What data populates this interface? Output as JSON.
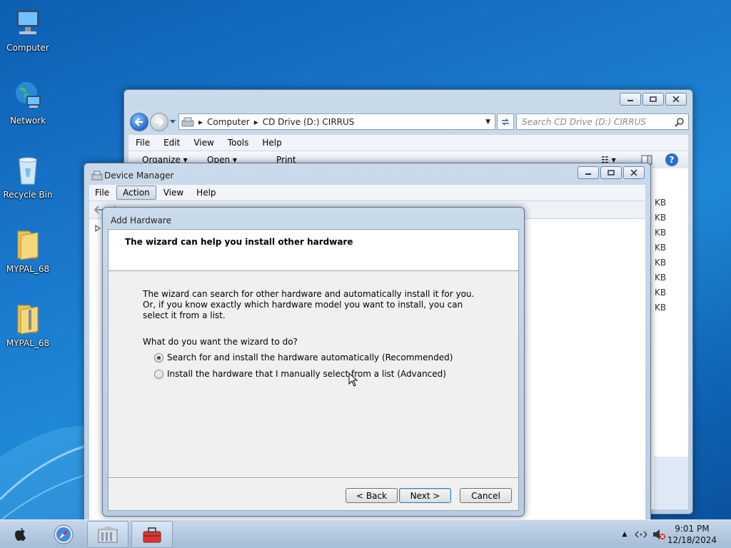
{
  "desktop": {
    "icons": [
      {
        "label": "Computer",
        "icon": "computer-icon"
      },
      {
        "label": "Network",
        "icon": "network-globe-icon"
      },
      {
        "label": "Recycle Bin",
        "icon": "recycle-bin-icon"
      },
      {
        "label": "MYPAL_68",
        "icon": "folder-icon"
      },
      {
        "label": "MYPAL_68",
        "icon": "zip-folder-icon"
      }
    ]
  },
  "explorer": {
    "breadcrumb": [
      "Computer",
      "CD Drive (D:) CIRRUS"
    ],
    "search_placeholder": "Search CD Drive (D:) CIRRUS",
    "menu": [
      "File",
      "Edit",
      "View",
      "Tools",
      "Help"
    ],
    "toolbar": {
      "organize": "Organize",
      "open": "Open",
      "print": "Print"
    },
    "sizes": [
      "KB",
      "KB",
      "KB",
      "KB",
      "KB",
      "KB",
      "KB",
      "KB"
    ]
  },
  "device_manager": {
    "title": "Device Manager",
    "menu": [
      "File",
      "Action",
      "View",
      "Help"
    ],
    "active_menu": "Action"
  },
  "add_hardware": {
    "title": "Add Hardware",
    "heading": "The wizard can help you install other hardware",
    "description": "The wizard can search for other hardware and automatically install it for you. Or, if you know exactly which hardware model you want to install, you can select it from a list.",
    "question": "What do you want the wizard to do?",
    "options": [
      {
        "label": "Search for and install the hardware automatically (Recommended)",
        "selected": true
      },
      {
        "label": "Install the hardware that I manually select from a list (Advanced)",
        "selected": false
      }
    ],
    "buttons": {
      "back": "< Back",
      "next": "Next >",
      "cancel": "Cancel"
    }
  },
  "taskbar": {
    "time": "9:01 PM",
    "date": "12/18/2024"
  },
  "colors": {
    "desktop": "#1a78cc",
    "window_frame": "#b9cde2",
    "dialog_body": "#f0f0f0"
  }
}
